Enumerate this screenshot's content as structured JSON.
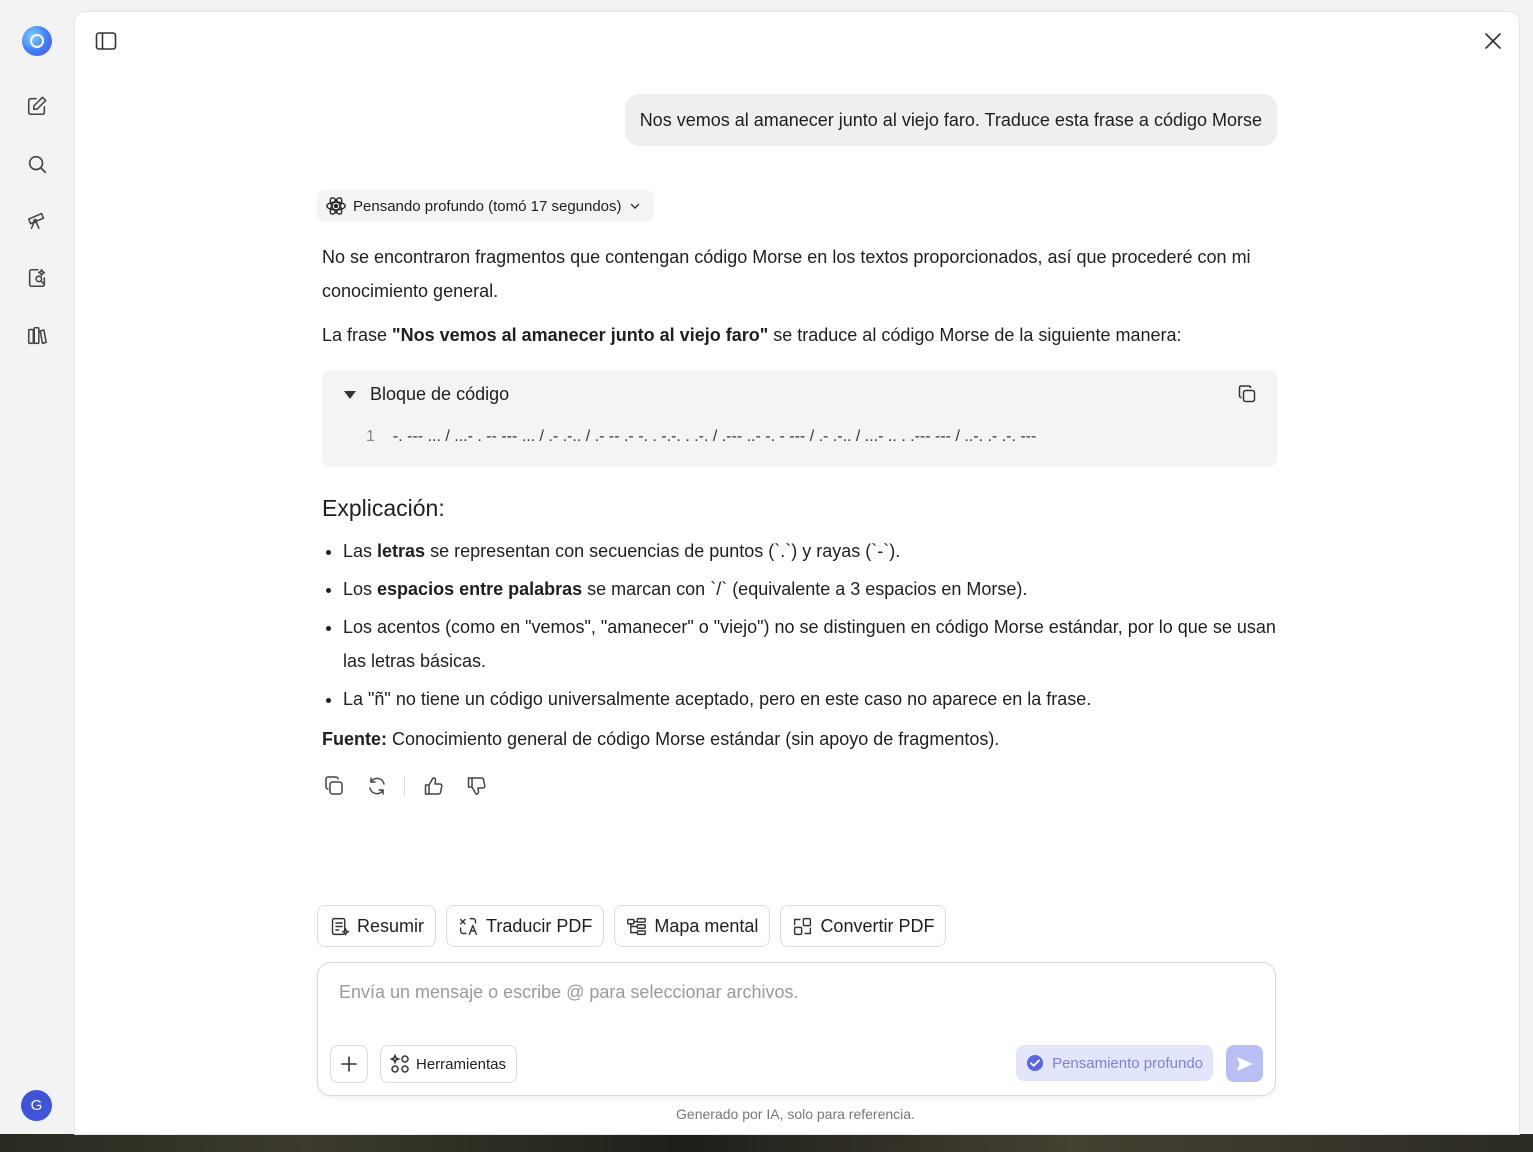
{
  "user_message": "Nos vemos al amanecer junto al viejo faro. Traduce esta frase a código Morse",
  "thinking_chip": "Pensando profundo (tomó 17 segundos)",
  "answer": {
    "intro": "No se encontraron fragmentos que contengan código Morse en los textos proporcionados, así que procederé con mi conocimiento general.",
    "phrase_prefix": "La frase ",
    "phrase_bold": "\"Nos vemos al amanecer junto al viejo faro\"",
    "phrase_suffix": " se traduce al código Morse de la siguiente manera:",
    "code_block": {
      "title": "Bloque de código",
      "line_number": "1",
      "line": "-. --- ... / ...- . -- --- ... / .- .-.. / .- -- .- -. . -.-. . .-. / .--- ..- -. - --- / .- .-.. / ...- .. . .--- --- / ..-. .- .-. ---"
    },
    "explanation_heading": "Explicación:",
    "points": [
      {
        "pre": "Las ",
        "bold": "letras",
        "post": " se representan con secuencias de puntos (`.`) y rayas (`-`)."
      },
      {
        "pre": "Los ",
        "bold": "espacios entre palabras",
        "post": " se marcan con `/` (equivalente a 3 espacios en Morse)."
      },
      {
        "pre": "Los acentos (como en \"vemos\", \"amanecer\" o \"viejo\") no se distinguen en código Morse estándar, por lo que se usan las letras básicas.",
        "bold": "",
        "post": ""
      },
      {
        "pre": "La \"ñ\" no tiene un código universalmente aceptado, pero en este caso no aparece en la frase.",
        "bold": "",
        "post": ""
      }
    ],
    "source_label": "Fuente:",
    "source_text": " Conocimiento general de código Morse estándar (sin apoyo de fragmentos)."
  },
  "quick_actions": [
    "Resumir",
    "Traducir PDF",
    "Mapa mental",
    "Convertir PDF"
  ],
  "composer": {
    "placeholder": "Envía un mensaje o escribe @ para seleccionar archivos.",
    "tools_label": "Herramientas",
    "deep_thinking_label": "Pensamiento profundo"
  },
  "disclaimer": "Generado por IA, solo para referencia.",
  "user_avatar_letter": "G",
  "colors": {
    "accent": "#3f54d6",
    "toggle_bg": "#e3e6fb",
    "send_bg": "#b9bff5"
  }
}
